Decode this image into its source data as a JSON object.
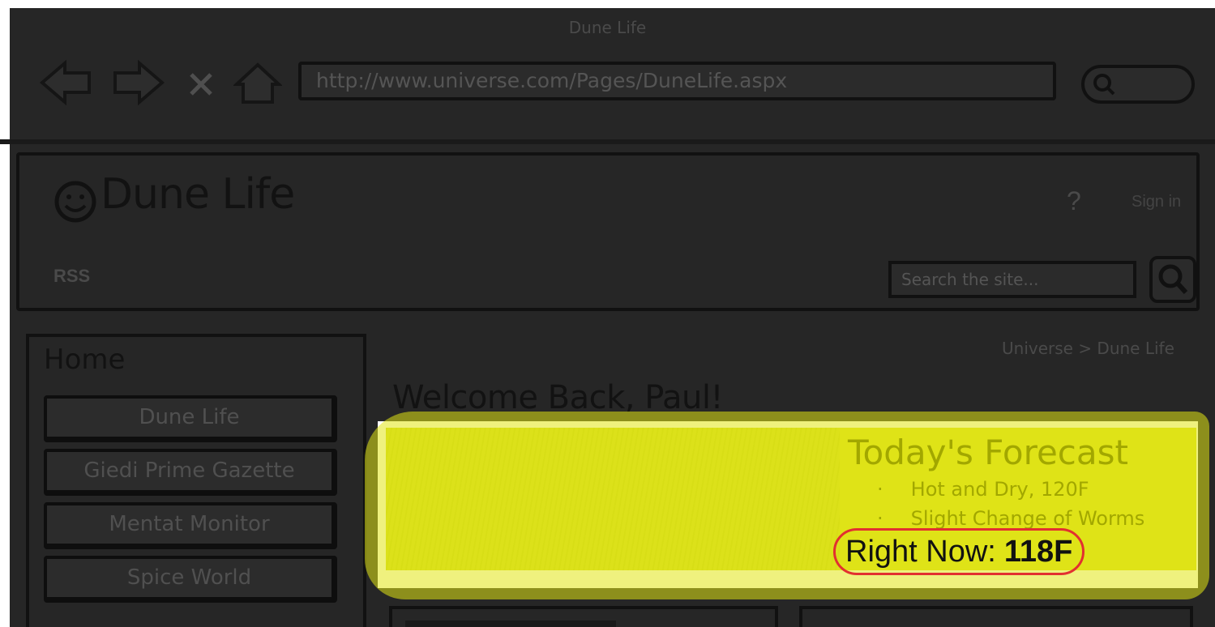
{
  "browser": {
    "window_title": "Dune Life",
    "url": "http://www.universe.com/Pages/DuneLife.aspx",
    "nav_icons": [
      "back-arrow-icon",
      "forward-arrow-icon",
      "stop-icon",
      "home-icon"
    ]
  },
  "header": {
    "site_title": "Dune Life",
    "help": "?",
    "link": "Sign in",
    "rss": "RSS",
    "search_placeholder": "Search the site..."
  },
  "sidebar": {
    "heading": "Home",
    "items": [
      {
        "label": "Dune Life"
      },
      {
        "label": "Giedi Prime Gazette"
      },
      {
        "label": "Mentat Monitor"
      },
      {
        "label": "Spice World"
      }
    ]
  },
  "main": {
    "breadcrumb": "Universe > Dune Life",
    "welcome": "Welcome Back, Paul!",
    "forecast": {
      "title": "Today's Forecast",
      "items": [
        "Hot and Dry, 120F",
        "Slight Change of Worms"
      ],
      "right_now_label": "Right Now:",
      "right_now_value": "118F"
    }
  },
  "colors": {
    "overlay": "#262626",
    "highlight": "#dbe11b",
    "annotation": "#e23030"
  }
}
